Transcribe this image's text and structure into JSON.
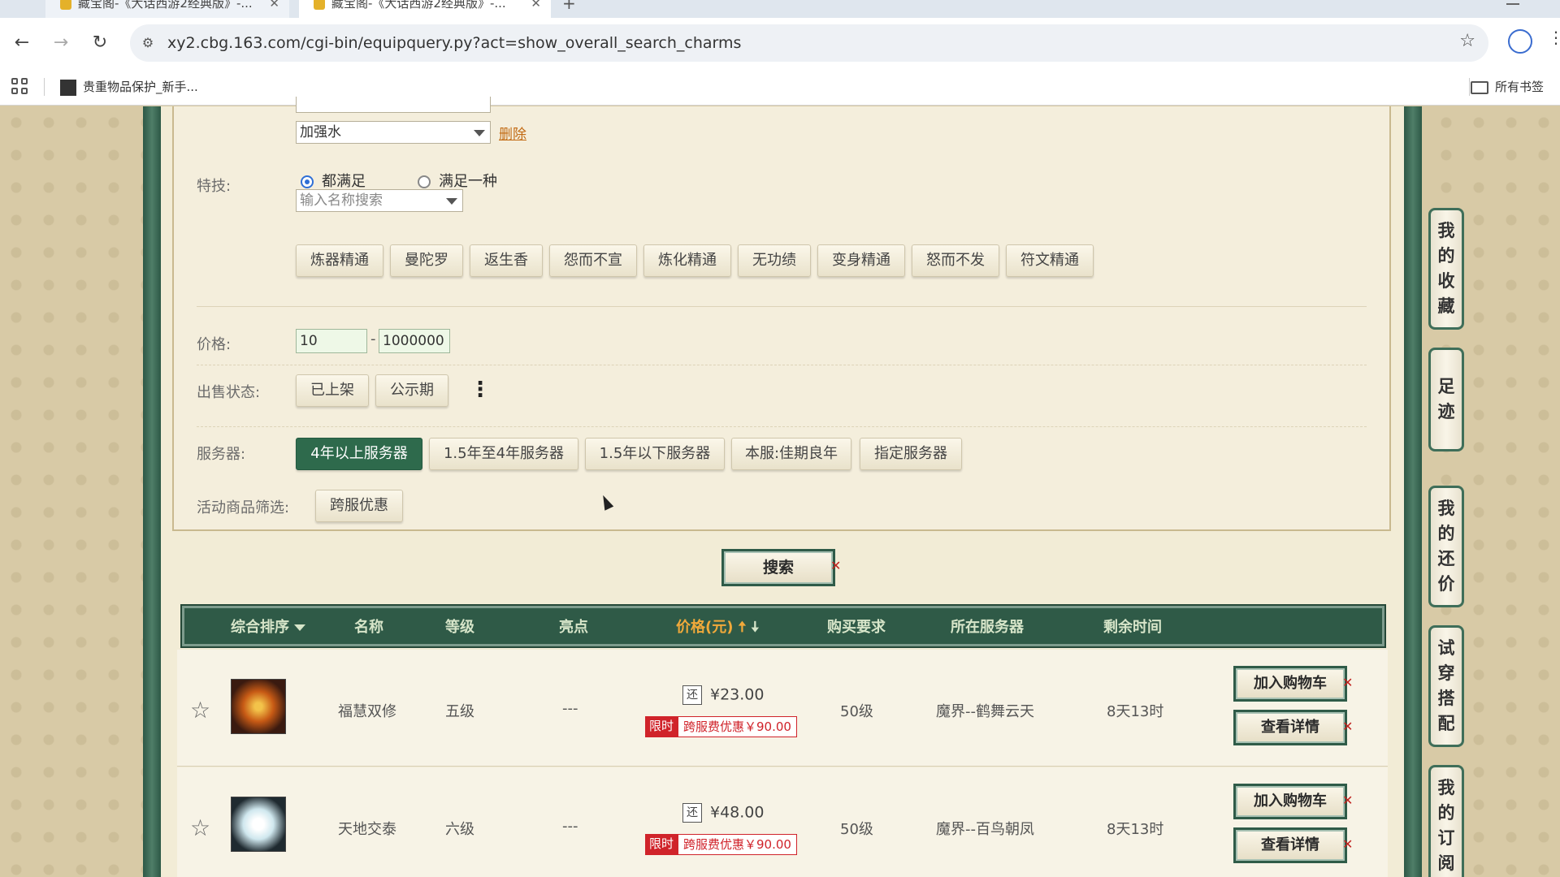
{
  "browser": {
    "tabs": [
      {
        "title": "藏宝阁-《大话西游2经典版》-..."
      },
      {
        "title": "藏宝阁-《大话西游2经典版》-..."
      }
    ],
    "new_tab": "+",
    "url": "xy2.cbg.163.com/cgi-bin/equipquery.py?act=show_overall_search_charms",
    "bookmarks": [
      {
        "label": "贵重物品保护_新手..."
      }
    ],
    "bookmarks_right": "所有书签"
  },
  "filters": {
    "top_select_value": "加强水",
    "delete_label": "删除",
    "skill_label": "特技:",
    "radio_all": "都满足",
    "radio_any": "满足一种",
    "skill_search_placeholder": "输入名称搜索",
    "skills": [
      "炼器精通",
      "曼陀罗",
      "返生香",
      "怨而不宣",
      "炼化精通",
      "无功绩",
      "变身精通",
      "怒而不发",
      "符文精通"
    ],
    "price_label": "价格:",
    "price_min": "10",
    "price_sep": "-",
    "price_max": "1000000",
    "sale_status_label": "出售状态:",
    "sale_status": [
      "已上架",
      "公示期"
    ],
    "more_label": "⋮",
    "server_label": "服务器:",
    "servers": [
      "4年以上服务器",
      "1.5年至4年服务器",
      "1.5年以下服务器",
      "本服:佳期良年",
      "指定服务器"
    ],
    "active_server_index": 0,
    "activity_label": "活动商品筛选:",
    "activity": [
      "跨服优惠"
    ]
  },
  "search_button": "搜索",
  "table": {
    "headers": {
      "sort": "综合排序",
      "name": "名称",
      "level": "等级",
      "highlight": "亮点",
      "price": "价格(元)",
      "buy_req": "购买要求",
      "server": "所在服务器",
      "time_left": "剩余时间"
    },
    "rows": [
      {
        "name": "福慧双修",
        "level": "五级",
        "highlight": "---",
        "price": "¥23.00",
        "bargain_icon": "还",
        "promo_tag": "限时",
        "promo_text": "跨服费优惠￥90.00",
        "buy_req": "50级",
        "server": "魔界--鹤舞云天",
        "time_left": "8天13时",
        "add_cart": "加入购物车",
        "detail": "查看详情",
        "thumb_color": "#b8501a"
      },
      {
        "name": "天地交泰",
        "level": "六级",
        "highlight": "---",
        "price": "¥48.00",
        "bargain_icon": "还",
        "promo_tag": "限时",
        "promo_text": "跨服费优惠￥90.00",
        "buy_req": "50级",
        "server": "魔界--百鸟朝凤",
        "time_left": "8天13时",
        "add_cart": "加入购物车",
        "detail": "查看详情",
        "thumb_color": "#dfeef3"
      }
    ]
  },
  "side_float": [
    {
      "chars": [
        "我",
        "的",
        "收",
        "藏"
      ]
    },
    {
      "chars": [
        "足",
        "迹"
      ]
    },
    {
      "chars": [
        "我",
        "的",
        "还",
        "价"
      ]
    },
    {
      "chars": [
        "试",
        "穿",
        "搭",
        "配"
      ]
    },
    {
      "chars": [
        "我",
        "的",
        "订",
        "阅"
      ]
    }
  ],
  "colors": {
    "accent_green": "#2e6a4c",
    "promo_red": "#d0232a",
    "price_orange": "#f0a93a"
  }
}
